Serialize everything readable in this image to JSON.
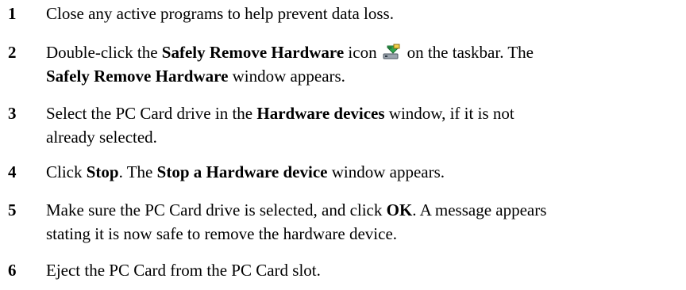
{
  "steps": [
    {
      "number": "1",
      "line1": "Close any active programs to help prevent data loss."
    },
    {
      "number": "2",
      "a": "Double-click the ",
      "b_bold": "Safely Remove Hardware",
      "c": " icon",
      "d": "on the taskbar. The",
      "line2_bold": "Safely Remove Hardware",
      "line2_rest": " window appears.",
      "icon": "safely-remove-hardware-icon"
    },
    {
      "number": "3",
      "a": "Select the PC Card drive in the ",
      "b_bold": "Hardware devices",
      "c": " window, if it is not",
      "line2": "already selected."
    },
    {
      "number": "4",
      "a": "Click ",
      "b_bold": "Stop",
      "c": ". The ",
      "d_bold": "Stop a Hardware device",
      "e": " window appears."
    },
    {
      "number": "5",
      "a": "Make sure the PC Card drive is selected, and click ",
      "b_bold": "OK",
      "c": ". A message appears",
      "line2": "stating it is now safe to remove the hardware device."
    },
    {
      "number": "6",
      "line1": "Eject the PC Card from the PC Card slot."
    }
  ]
}
